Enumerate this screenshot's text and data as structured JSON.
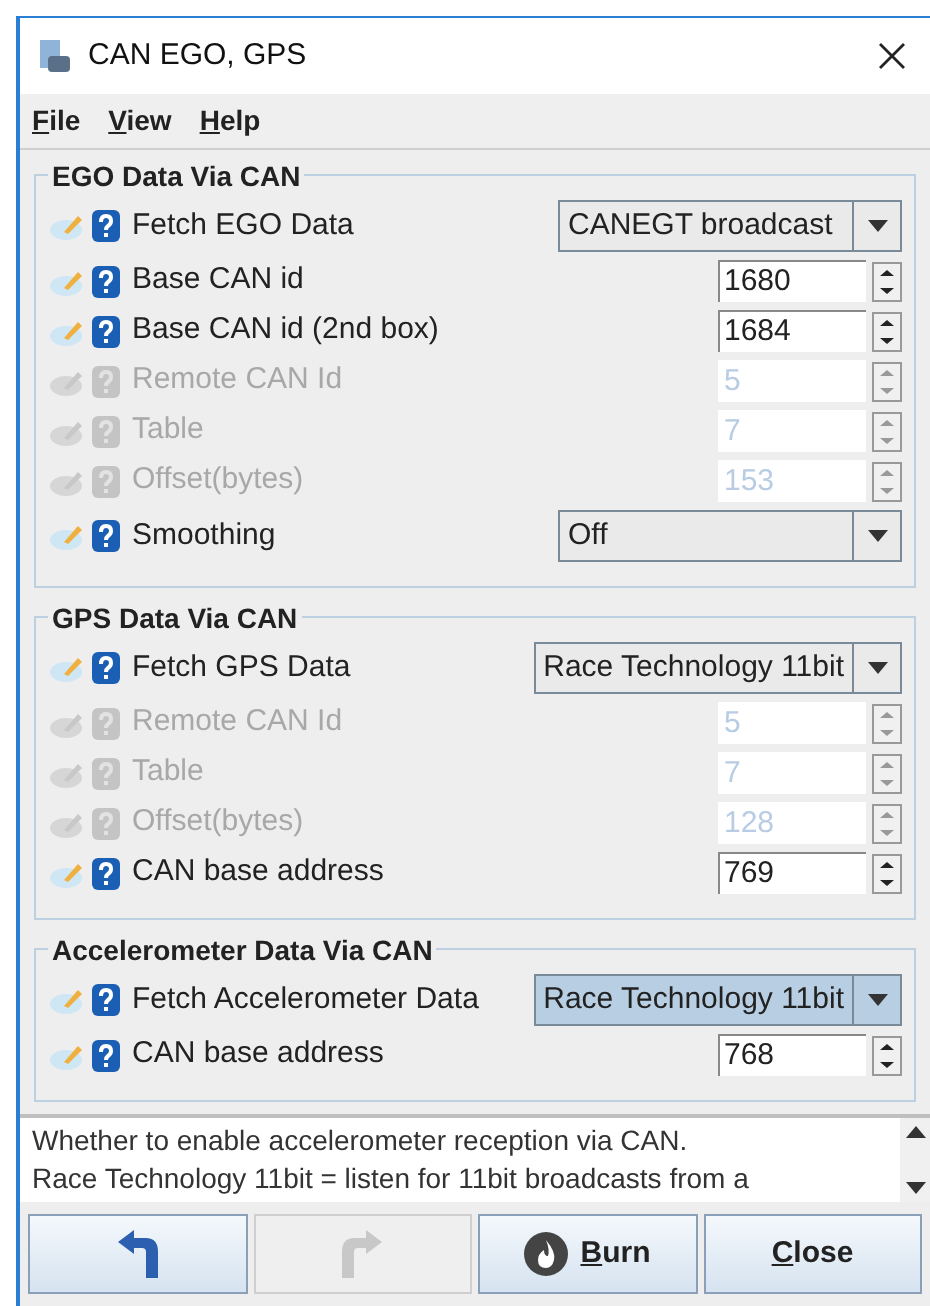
{
  "window": {
    "title": "CAN EGO, GPS"
  },
  "menu": [
    {
      "label": "File"
    },
    {
      "label": "View"
    },
    {
      "label": "Help"
    }
  ],
  "sections": [
    {
      "title": "EGO Data Via CAN",
      "rows": [
        {
          "kind": "combo",
          "label": "Fetch EGO Data",
          "value": "CANEGT broadcast",
          "disabled": false,
          "focused": false
        },
        {
          "kind": "spinner",
          "label": "Base CAN id",
          "value": "1680",
          "disabled": false
        },
        {
          "kind": "spinner",
          "label": "Base CAN id (2nd box)",
          "value": "1684",
          "disabled": false
        },
        {
          "kind": "spinner",
          "label": "Remote CAN Id",
          "value": "5",
          "disabled": true
        },
        {
          "kind": "spinner",
          "label": "Table",
          "value": "7",
          "disabled": true
        },
        {
          "kind": "spinner",
          "label": "Offset(bytes)",
          "value": "153",
          "disabled": true
        },
        {
          "kind": "combo",
          "label": "Smoothing",
          "value": "Off",
          "disabled": false,
          "focused": false
        }
      ]
    },
    {
      "title": "GPS Data Via CAN",
      "rows": [
        {
          "kind": "combo",
          "label": "Fetch GPS Data",
          "value": "Race Technology 11bit",
          "disabled": false,
          "focused": false
        },
        {
          "kind": "spinner",
          "label": "Remote CAN Id",
          "value": "5",
          "disabled": true
        },
        {
          "kind": "spinner",
          "label": "Table",
          "value": "7",
          "disabled": true
        },
        {
          "kind": "spinner",
          "label": "Offset(bytes)",
          "value": "128",
          "disabled": true
        },
        {
          "kind": "spinner",
          "label": "CAN base address",
          "value": "769",
          "disabled": false
        }
      ]
    },
    {
      "title": "Accelerometer Data Via CAN",
      "rows": [
        {
          "kind": "combo",
          "label": "Fetch Accelerometer Data",
          "value": "Race Technology 11bit",
          "disabled": false,
          "focused": true
        },
        {
          "kind": "spinner",
          "label": "CAN base address",
          "value": "768",
          "disabled": false
        }
      ]
    }
  ],
  "help_text": [
    "Whether to enable accelerometer reception via CAN.",
    "Race Technology 11bit = listen for 11bit broadcasts from a"
  ],
  "buttons": [
    {
      "kind": "undo",
      "disabled": false
    },
    {
      "kind": "redo",
      "disabled": true
    },
    {
      "kind": "burn",
      "label": "Burn",
      "disabled": false
    },
    {
      "kind": "close",
      "label": "Close",
      "disabled": false
    }
  ]
}
